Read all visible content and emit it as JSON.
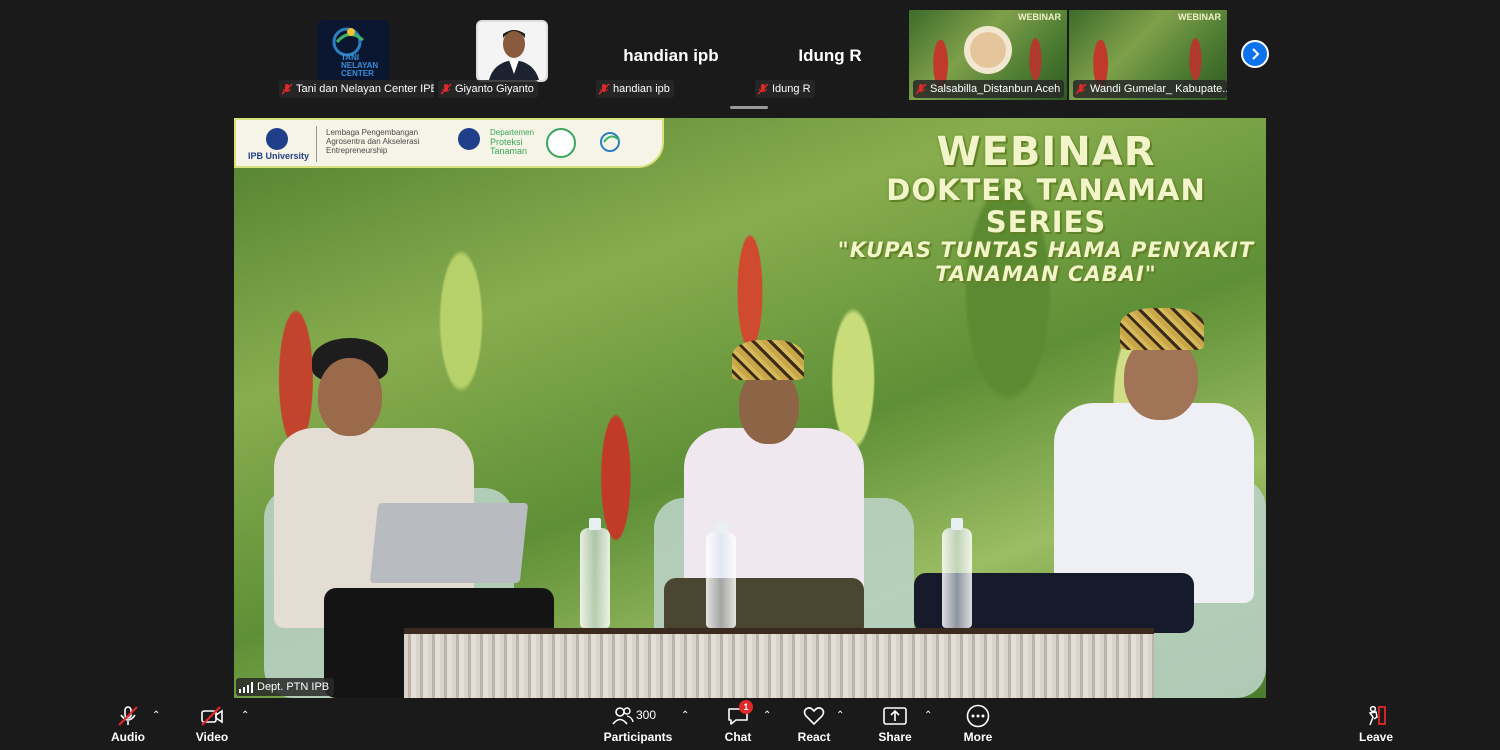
{
  "thumbnails": [
    {
      "name": "Tani dan Nelayan Center IPB",
      "logo_text": "TANI NELAYAN CENTER"
    },
    {
      "name": "Giyanto Giyanto"
    },
    {
      "name": "handian ipb",
      "display": "handian ipb"
    },
    {
      "name": "Idung R",
      "display": "Idung R"
    }
  ],
  "video_thumbnails": [
    {
      "name": "Salsabilla_Distanbun Aceh",
      "title": "WEBINAR"
    },
    {
      "name": "Wandi Gumelar_ Kabupate...",
      "title": "WEBINAR"
    }
  ],
  "main_video": {
    "speaker_label": "Dept. PTN IPB",
    "banner": {
      "university": "IPB University",
      "institute": "Lembaga Pengembangan Agrosentra dan Akselerasi Entrepreneurship",
      "program": "Proteksi Tanaman",
      "program_prefix": "Departemen"
    },
    "title_line1": "WEBINAR",
    "title_line2": "DOKTER TANAMAN SERIES",
    "title_line3": "\"KUPAS TUNTAS HAMA PENYAKIT",
    "title_line4": "TANAMAN CABAI\""
  },
  "toolbar": {
    "audio": "Audio",
    "video": "Video",
    "participants": "Participants",
    "participants_count": "300",
    "chat": "Chat",
    "chat_badge": "1",
    "react": "React",
    "share": "Share",
    "more": "More",
    "leave": "Leave"
  },
  "colors": {
    "accent": "#0e72ed",
    "badge": "#e02828",
    "muted": "#e02828",
    "background": "#1a1a1a"
  }
}
